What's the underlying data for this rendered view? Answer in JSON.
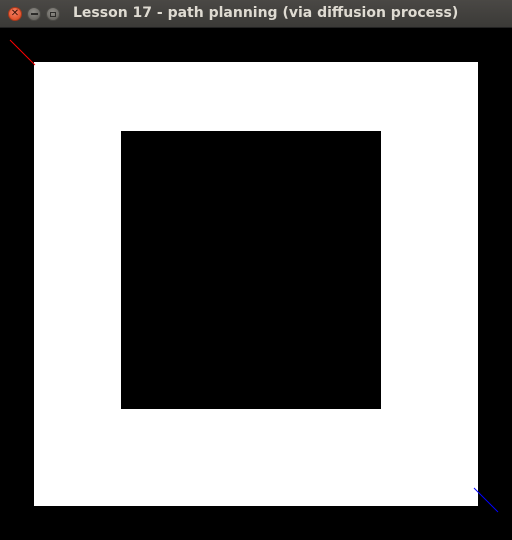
{
  "window": {
    "title": "Lesson 17 - path planning (via diffusion process)",
    "controls": [
      "close-icon",
      "minimize-icon",
      "maximize-icon"
    ]
  },
  "map": {
    "colors": {
      "wall": "#000000",
      "free": "#ffffff",
      "start_marker": "#ff0000",
      "goal_marker": "#0000ff"
    },
    "markers": [
      "start",
      "goal"
    ]
  }
}
